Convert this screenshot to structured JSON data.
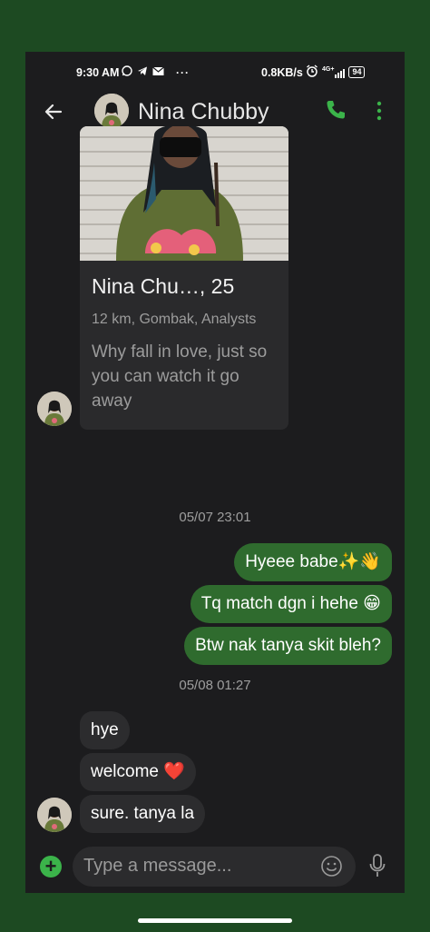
{
  "status_bar": {
    "time": "9:30 AM",
    "speed": "0.8KB/s",
    "network": "4G+",
    "battery": "94",
    "left_icons": [
      "whatsapp-icon",
      "telegram-icon",
      "mail-icon",
      "more-icon"
    ],
    "right_icons": [
      "alarm-icon",
      "signal-icon",
      "battery-icon"
    ]
  },
  "header": {
    "contact_name": "Nina Chubby",
    "icons": [
      "back-arrow-icon",
      "phone-icon",
      "more-vertical-icon"
    ],
    "accent_color": "#3bb34a"
  },
  "profile_card": {
    "name_age": "Nina Chu…, 25",
    "meta": "12 km, Gombak, Analysts",
    "bio": "Why fall in love, just so you can watch it go away"
  },
  "messages": [
    {
      "type": "timestamp",
      "text": "05/07 23:01"
    },
    {
      "type": "outgoing",
      "text": "Hyeee babe✨👋"
    },
    {
      "type": "outgoing",
      "text": "Tq match dgn i hehe 😁"
    },
    {
      "type": "outgoing",
      "text": "Btw nak tanya skit bleh?"
    },
    {
      "type": "timestamp",
      "text": "05/08 01:27"
    },
    {
      "type": "incoming",
      "text": "hye"
    },
    {
      "type": "incoming",
      "text": "welcome ❤️"
    },
    {
      "type": "incoming",
      "text": "sure. tanya la"
    }
  ],
  "input_bar": {
    "placeholder": "Type a message...",
    "icons": [
      "plus-icon",
      "emoji-icon",
      "mic-icon"
    ]
  },
  "colors": {
    "outgoing_bubble": "#2f6b2e",
    "incoming_bubble": "#2c2c2e",
    "background": "#1c1c1e",
    "frame": "#1d4a22"
  }
}
